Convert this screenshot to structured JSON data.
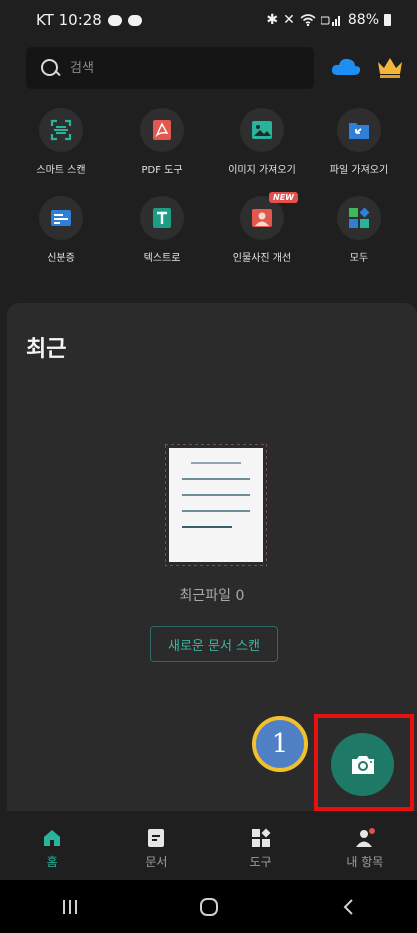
{
  "status_bar": {
    "carrier_time": "KT 10:28",
    "battery_percent": "88%"
  },
  "search": {
    "placeholder": "검색"
  },
  "tools": [
    {
      "label": "스마트 스캔",
      "icon": "smart-scan-icon"
    },
    {
      "label": "PDF 도구",
      "icon": "pdf-icon"
    },
    {
      "label": "이미지 가져오기",
      "icon": "image-import-icon"
    },
    {
      "label": "파일 가져오기",
      "icon": "file-import-icon"
    },
    {
      "label": "신분증",
      "icon": "id-card-icon"
    },
    {
      "label": "텍스트로",
      "icon": "text-icon"
    },
    {
      "label": "인물사진 개선",
      "icon": "portrait-icon",
      "badge": "NEW"
    },
    {
      "label": "모두",
      "icon": "all-apps-icon"
    }
  ],
  "recent": {
    "title": "최근",
    "empty_text": "최근파일 0",
    "scan_button_label": "새로운 문서 스캔"
  },
  "annotation": {
    "step_number": "1"
  },
  "bottom_nav": [
    {
      "label": "홈",
      "active": true
    },
    {
      "label": "문서",
      "active": false
    },
    {
      "label": "도구",
      "active": false
    },
    {
      "label": "내 항목",
      "active": false
    }
  ],
  "colors": {
    "accent": "#29b39a",
    "fab": "#1e7a66",
    "highlight": "#e80f0f",
    "marker": "#4f80c5",
    "marker_border": "#f2c02d"
  }
}
